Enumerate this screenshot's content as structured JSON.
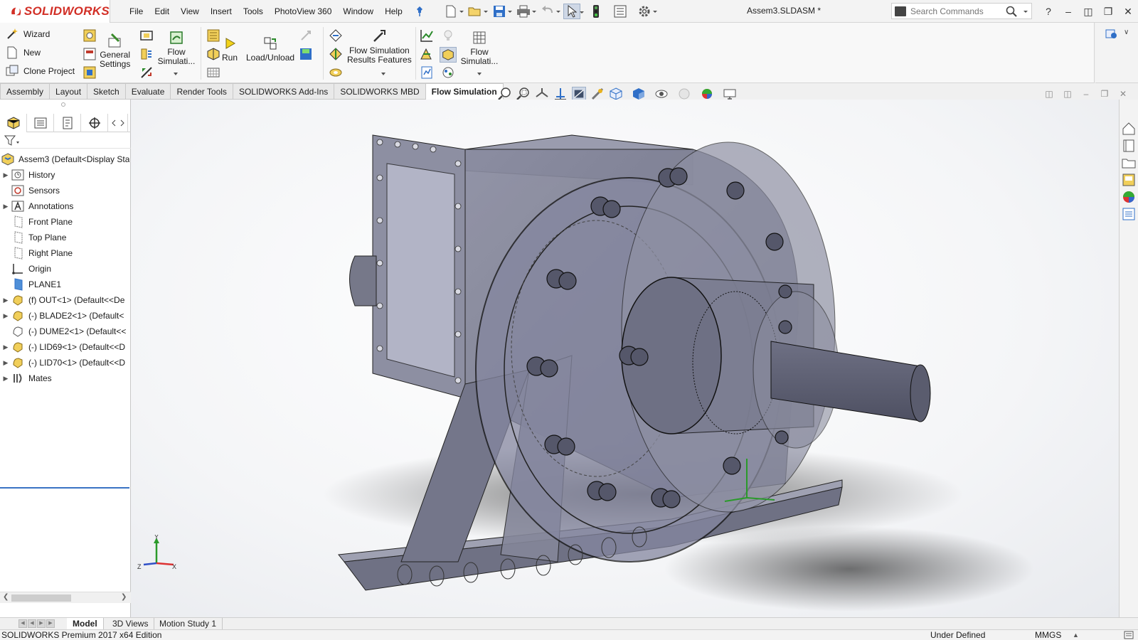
{
  "app": {
    "brand_prefix": "3S",
    "brand": "SOLIDWORKS",
    "document_title": "Assem3.SLDASM *"
  },
  "menu": [
    "File",
    "Edit",
    "View",
    "Insert",
    "Tools",
    "PhotoView 360",
    "Window",
    "Help"
  ],
  "search": {
    "placeholder": "Search Commands"
  },
  "commands": {
    "wizard": "Wizard",
    "new": "New",
    "clone_project": "Clone Project",
    "general_settings_1": "General",
    "general_settings_2": "Settings",
    "flow_simulation_1": "Flow",
    "flow_simulation_2": "Simulati...",
    "run": "Run",
    "load_unload": "Load/Unload",
    "results_features_1": "Flow Simulation",
    "results_features_2": "Results Features",
    "flow_sim_tools_1": "Flow",
    "flow_sim_tools_2": "Simulati..."
  },
  "tabs": [
    {
      "label": "Assembly",
      "active": false
    },
    {
      "label": "Layout",
      "active": false
    },
    {
      "label": "Sketch",
      "active": false
    },
    {
      "label": "Evaluate",
      "active": false
    },
    {
      "label": "Render Tools",
      "active": false
    },
    {
      "label": "SOLIDWORKS Add-Ins",
      "active": false
    },
    {
      "label": "SOLIDWORKS MBD",
      "active": false
    },
    {
      "label": "Flow Simulation",
      "active": true
    }
  ],
  "tree": {
    "root": "Assem3  (Default<Display Stat",
    "items": [
      {
        "label": "History",
        "expandable": true,
        "icon": "history-icon"
      },
      {
        "label": "Sensors",
        "expandable": false,
        "icon": "sensors-icon"
      },
      {
        "label": "Annotations",
        "expandable": true,
        "icon": "annotations-icon"
      },
      {
        "label": "Front Plane",
        "expandable": false,
        "icon": "plane-icon"
      },
      {
        "label": "Top Plane",
        "expandable": false,
        "icon": "plane-icon"
      },
      {
        "label": "Right Plane",
        "expandable": false,
        "icon": "plane-icon"
      },
      {
        "label": "Origin",
        "expandable": false,
        "icon": "origin-icon"
      },
      {
        "label": "PLANE1",
        "expandable": false,
        "icon": "plane-filled-icon"
      },
      {
        "label": "(f) OUT<1> (Default<<De",
        "expandable": true,
        "icon": "part-icon"
      },
      {
        "label": "(-) BLADE2<1> (Default<",
        "expandable": true,
        "icon": "part-icon"
      },
      {
        "label": "(-) DUME2<1> (Default<<",
        "expandable": false,
        "icon": "part-outline-icon"
      },
      {
        "label": "(-) LID69<1> (Default<<D",
        "expandable": true,
        "icon": "part-icon"
      },
      {
        "label": "(-) LID70<1> (Default<<D",
        "expandable": true,
        "icon": "part-icon"
      },
      {
        "label": "Mates",
        "expandable": true,
        "icon": "mates-icon"
      }
    ]
  },
  "triad": {
    "x": "X",
    "y": "Y",
    "z": "Z"
  },
  "bottom_tabs": [
    {
      "label": "Model",
      "active": true
    },
    {
      "label": "3D Views",
      "active": false
    },
    {
      "label": "Motion Study 1",
      "active": false
    }
  ],
  "status": {
    "edition": "SOLIDWORKS Premium 2017 x64 Edition",
    "state": "Under Defined",
    "units": "MMGS"
  },
  "colors": {
    "brand_red": "#d22f26",
    "accent_blue": "#3a73c4",
    "model_fill": "#7d7f92"
  }
}
